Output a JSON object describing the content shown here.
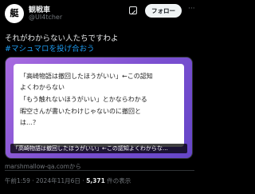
{
  "post": {
    "author": {
      "avatar_text": "艇",
      "display_name": "観戦車",
      "handle": "@UI4tcher"
    },
    "follow_label": "フォロー",
    "more_label": "···",
    "text": "それがわからない人たちですわよ",
    "hashtag": "#マシュマロを投げ合おう",
    "card": {
      "lines": [
        "「高崎物語は撤回したほうがいい」←この認知",
        "よくわからない",
        "「もう触れないほうがいい」とかならわかる",
        "暇空さんが書いたわけじゃないのに撤回と",
        "は…？"
      ],
      "caption": "「高崎物語は撤回したほうがいい」←この認知よくわからな…",
      "source": "marshmallow-qa.comから"
    },
    "meta": {
      "time": "午前1:59",
      "separator": "·",
      "date": "2024年11月6日",
      "views": "5,371",
      "views_label": "件の表示"
    }
  }
}
